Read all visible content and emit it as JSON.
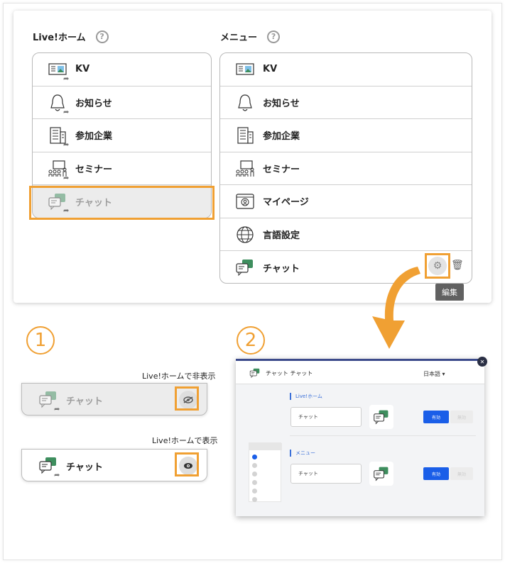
{
  "left_column": {
    "title": "Live!ホーム",
    "help": "?"
  },
  "right_column": {
    "title": "メニュー",
    "help": "?"
  },
  "home_items": [
    {
      "label": "KV",
      "icon": "kv-icon"
    },
    {
      "label": "お知らせ",
      "icon": "bell-icon"
    },
    {
      "label": "参加企業",
      "icon": "building-icon"
    },
    {
      "label": "セミナー",
      "icon": "seminar-icon"
    },
    {
      "label": "チャット",
      "icon": "chat-icon"
    }
  ],
  "menu_items": [
    {
      "label": "KV",
      "icon": "kv-icon"
    },
    {
      "label": "お知らせ",
      "icon": "bell-icon"
    },
    {
      "label": "参加企業",
      "icon": "building-icon"
    },
    {
      "label": "セミナー",
      "icon": "seminar-icon"
    },
    {
      "label": "マイページ",
      "icon": "mypage-icon"
    },
    {
      "label": "言語設定",
      "icon": "globe-icon"
    },
    {
      "label": "チャット",
      "icon": "chat-icon"
    }
  ],
  "edit_tooltip": "編集",
  "step1": {
    "number": "1",
    "hidden_caption": "Live!ホームで非表示",
    "hidden_label": "チャット",
    "shown_caption": "Live!ホームで表示",
    "shown_label": "チャット"
  },
  "step2": {
    "number": "2",
    "header_title": "チャット チャット",
    "language": "日本語 ▾",
    "section_home": "Live!ホーム",
    "section_menu": "メニュー",
    "home_input": "チャット",
    "menu_input": "チャット",
    "enable_label": "有効",
    "disable_label": "無効"
  },
  "colors": {
    "accent_orange": "#f0a033",
    "chat_green": "#3e8e5e",
    "enable_blue": "#1a5ee8"
  }
}
